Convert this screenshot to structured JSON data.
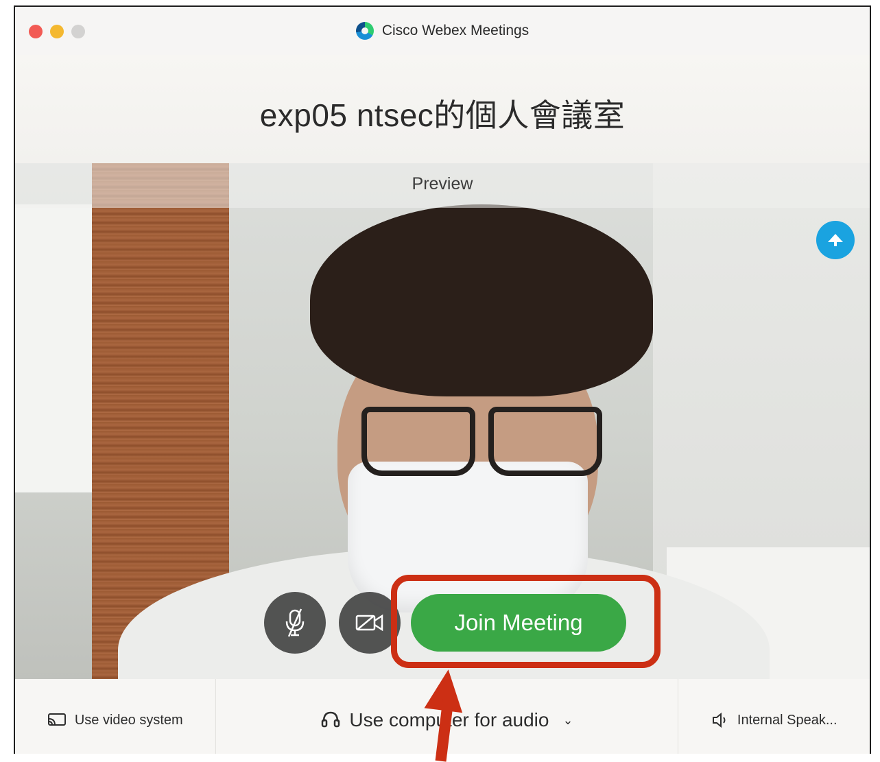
{
  "window": {
    "app_title": "Cisco Webex Meetings",
    "meeting_title": "exp05 ntsec的個人會議室"
  },
  "preview": {
    "label": "Preview"
  },
  "controls": {
    "mute_icon": "microphone-off-icon",
    "video_icon": "camera-off-icon",
    "join_label": "Join Meeting",
    "join_color": "#3aa846"
  },
  "bottom_bar": {
    "video_system_label": "Use video system",
    "audio_label": "Use computer for audio",
    "speaker_label": "Internal Speak..."
  },
  "annotation": {
    "highlight_color": "#cc2f14"
  }
}
